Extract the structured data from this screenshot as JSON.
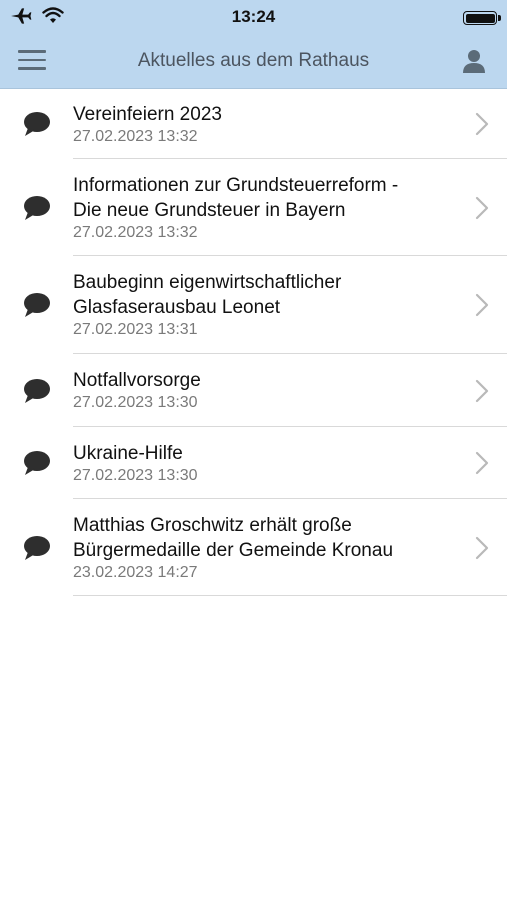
{
  "status_bar": {
    "time": "13:24",
    "left_icons": [
      "airplane-icon",
      "wifi-icon"
    ],
    "right_icons": [
      "battery-icon"
    ]
  },
  "nav": {
    "title": "Aktuelles aus dem Rathaus",
    "left_icon": "hamburger-menu-icon",
    "right_icon": "person-icon"
  },
  "colors": {
    "header_bg": "#bcd7ef",
    "title_text": "#4c5560",
    "date_text": "#7a7a7a",
    "divider": "#d9d9d9"
  },
  "news": [
    {
      "title_lines": [
        "Vereinfeiern 2023"
      ],
      "date": "27.02.2023 13:32",
      "icon": "speech-bubble-icon"
    },
    {
      "title_lines": [
        "Informationen zur Grundsteuerreform -",
        "Die neue Grundsteuer in Bayern"
      ],
      "date": "27.02.2023 13:32",
      "icon": "speech-bubble-icon"
    },
    {
      "title_lines": [
        "Baubeginn eigenwirtschaftlicher",
        "Glasfaserausbau Leonet"
      ],
      "date": "27.02.2023 13:31",
      "icon": "speech-bubble-icon"
    },
    {
      "title_lines": [
        "Notfallvorsorge"
      ],
      "date": "27.02.2023 13:30",
      "icon": "speech-bubble-icon"
    },
    {
      "title_lines": [
        "Ukraine-Hilfe"
      ],
      "date": "27.02.2023 13:30",
      "icon": "speech-bubble-icon"
    },
    {
      "title_lines": [
        "Matthias Groschwitz erhält große",
        "Bürgermedaille der Gemeinde Kronau"
      ],
      "date": "23.02.2023 14:27",
      "icon": "speech-bubble-icon"
    }
  ]
}
